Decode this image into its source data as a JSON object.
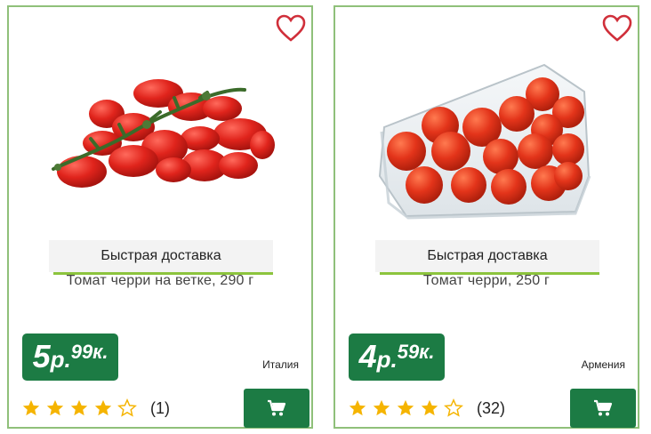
{
  "colors": {
    "accent_green": "#1c7b44",
    "underline_green": "#8cc43d",
    "heart_red": "#d02f3a",
    "star_gold": "#f5b400",
    "card_border": "#8fc07a"
  },
  "products": [
    {
      "delivery": "Быстрая доставка",
      "title": "Томат черри на ветке, 290 г",
      "price_rub": "5",
      "price_rub_suffix": "р.",
      "price_kop": "99к.",
      "country": "Италия",
      "rating": 4,
      "rating_max": 5,
      "reviews": "(1)",
      "image_icon": "cherry-tomatoes-on-vine"
    },
    {
      "delivery": "Быстрая доставка",
      "title": "Томат черри, 250 г",
      "price_rub": "4",
      "price_rub_suffix": "р.",
      "price_kop": "59к.",
      "country": "Армения",
      "rating": 4,
      "rating_max": 5,
      "reviews": "(32)",
      "image_icon": "cherry-tomatoes-in-plastic-box"
    }
  ],
  "icons": {
    "favorite": "heart-icon",
    "cart": "cart-icon",
    "star": "star-icon"
  }
}
